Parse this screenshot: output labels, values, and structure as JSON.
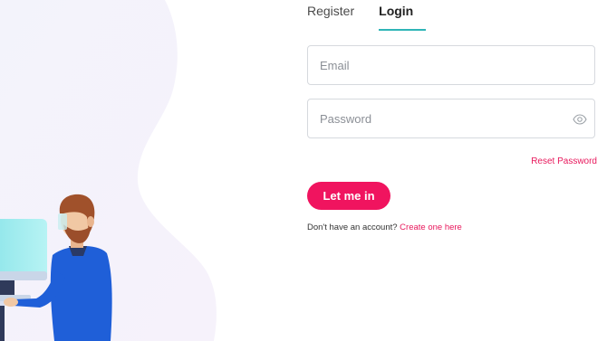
{
  "tabs": [
    {
      "label": "Register",
      "active": false
    },
    {
      "label": "Login",
      "active": true
    }
  ],
  "form": {
    "email_placeholder": "Email",
    "password_placeholder": "Password",
    "reset_link": "Reset Password",
    "submit_label": "Let me in",
    "signup_prompt": "Don't have an account?",
    "signup_link": "Create one here"
  },
  "icons": {
    "password_toggle": "eye-icon"
  },
  "colors": {
    "accent_pink": "#f0145f",
    "accent_teal": "#2fb5b7",
    "field_border": "#d6d9de",
    "illustration_bg": "#f3f2fb"
  }
}
